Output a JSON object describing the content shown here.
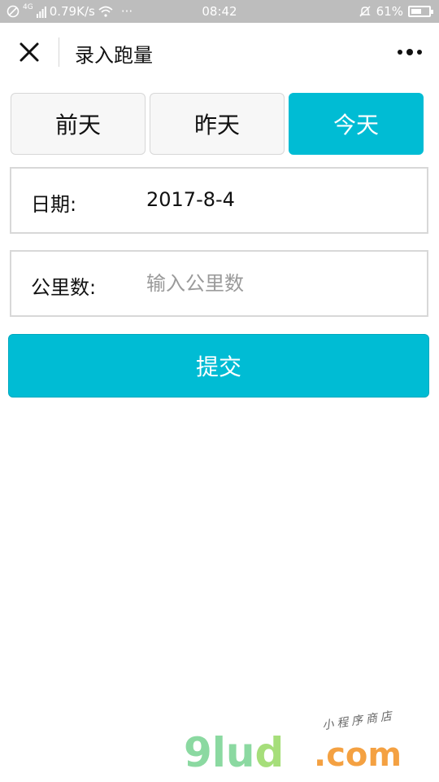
{
  "status_bar": {
    "network": "4G",
    "speed": "0.79K/s",
    "dots": "···",
    "time": "08:42",
    "battery_percent": "61%",
    "battery_level": 0.61
  },
  "navbar": {
    "title": "录入跑量",
    "close_icon": "close-icon",
    "more_icon": "more-icon"
  },
  "tabs": [
    {
      "label": "前天",
      "active": false
    },
    {
      "label": "昨天",
      "active": false
    },
    {
      "label": "今天",
      "active": true
    }
  ],
  "form": {
    "date_label": "日期:",
    "date_value": "2017-8-4",
    "km_label": "公里数:",
    "km_placeholder": "输入公里数",
    "km_value": ""
  },
  "submit_label": "提交",
  "watermark": {
    "brand_9": "9",
    "brand_lu": "lu",
    "brand_d": "d",
    "tagline": "小程序商店",
    "domain": ".com"
  },
  "colors": {
    "accent": "#00bcd4",
    "status_bar": "#bdbdbd"
  }
}
